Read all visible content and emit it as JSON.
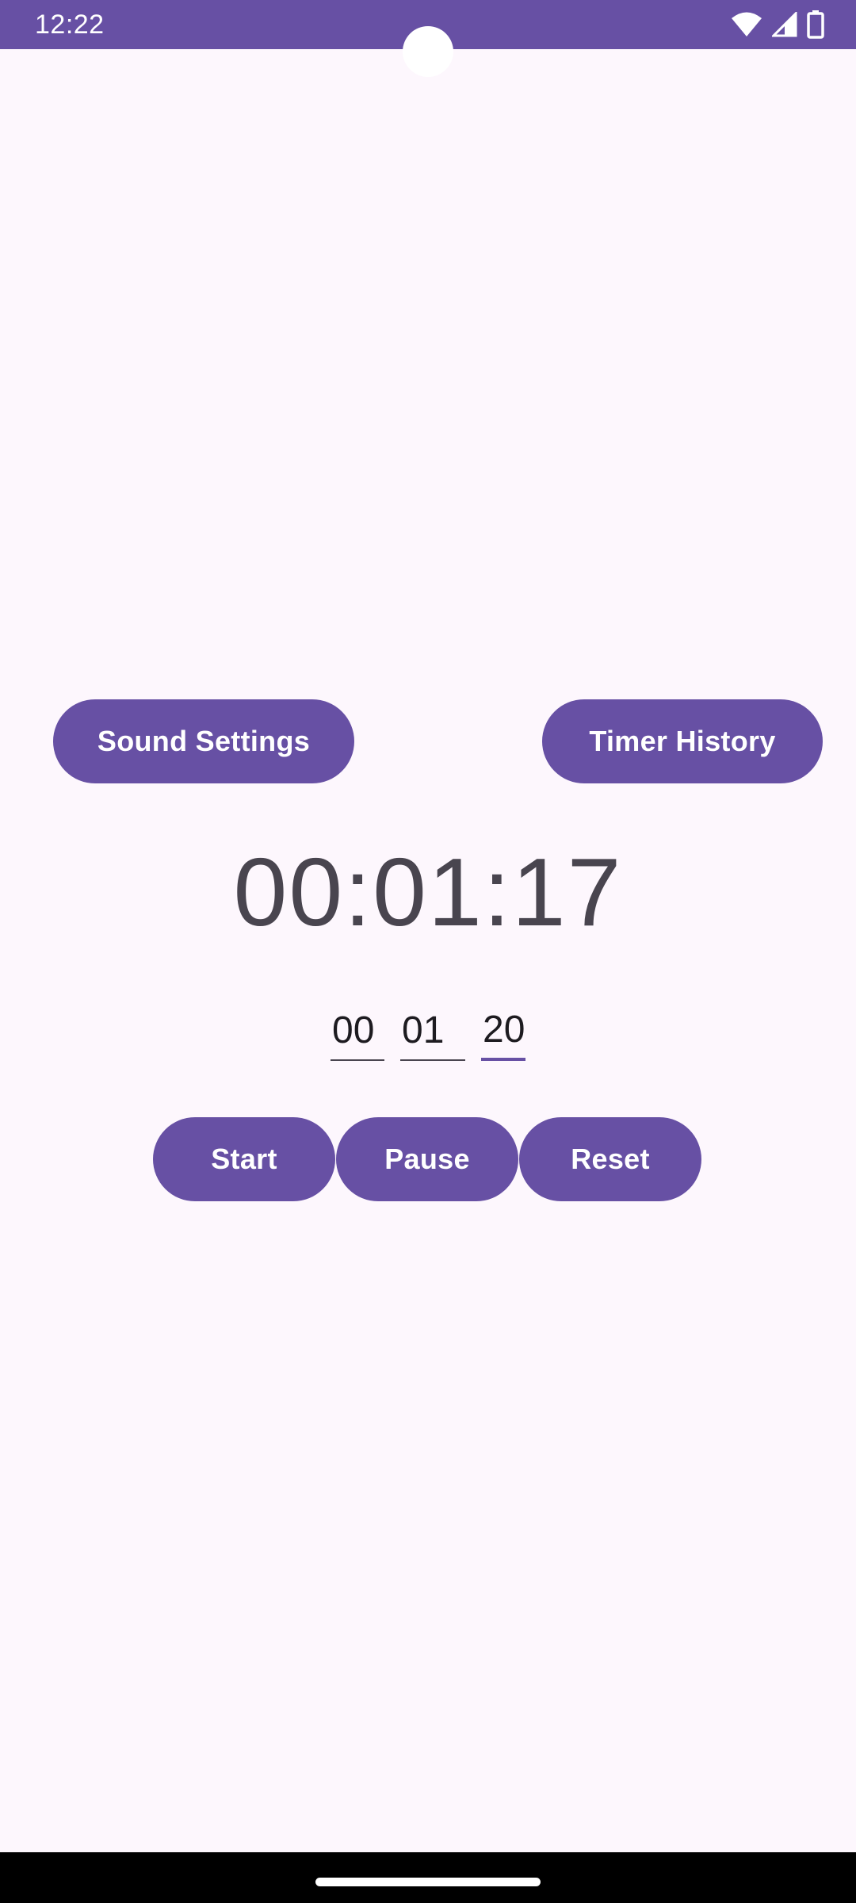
{
  "status_bar": {
    "time": "12:22",
    "background_color": "#6750a4",
    "icons": [
      "wifi-icon",
      "signal-icon",
      "battery-icon"
    ]
  },
  "actions": {
    "sound_settings_label": "Sound Settings",
    "timer_history_label": "Timer History"
  },
  "timer": {
    "display": "00:01:17"
  },
  "inputs": {
    "hours": "00",
    "minutes": "01",
    "seconds": "20"
  },
  "controls": {
    "start_label": "Start",
    "pause_label": "Pause",
    "reset_label": "Reset"
  },
  "theme": {
    "accent": "#6750a4",
    "background": "#fdf7fd",
    "timer_text": "#49454f"
  }
}
